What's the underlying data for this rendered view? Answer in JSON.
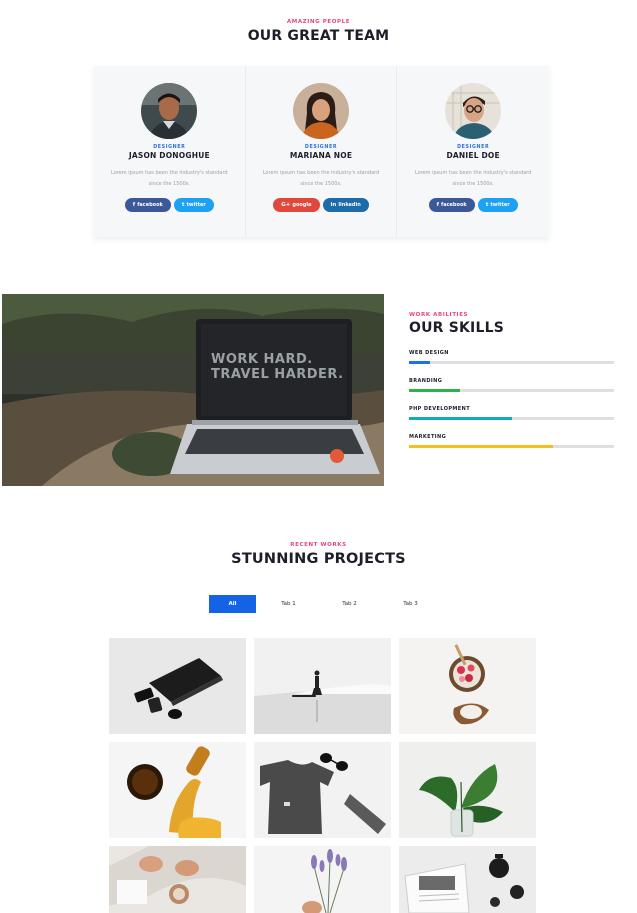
{
  "team": {
    "eyebrow": "AMAZING PEOPLE",
    "title": "OUR GREAT TEAM",
    "members": [
      {
        "role": "DESIGNER",
        "name": "JASON DONOGHUE",
        "bio": "Lorem ipsum has been the industry's standard since the 1500s.",
        "buttons": [
          {
            "icon": "f",
            "label": "facebook"
          },
          {
            "icon": "t",
            "label": "twitter"
          }
        ]
      },
      {
        "role": "DESIGNER",
        "name": "MARIANA NOE",
        "bio": "Lorem ipsum has been the industry's standard since the 1500s.",
        "buttons": [
          {
            "icon": "G+",
            "label": "google"
          },
          {
            "icon": "in",
            "label": "linkedin"
          }
        ]
      },
      {
        "role": "DESIGNER",
        "name": "DANIEL DOE",
        "bio": "Lorem ipsum has been the industry's standard since the 1500s.",
        "buttons": [
          {
            "icon": "f",
            "label": "facebook"
          },
          {
            "icon": "t",
            "label": "twitter"
          }
        ]
      }
    ]
  },
  "hero": {
    "screen_text_1": "WORK HARD.",
    "screen_text_2": "TRAVEL HARDER."
  },
  "skills": {
    "eyebrow": "WORK ABILITIES",
    "title": "OUR SKILLS",
    "items": [
      {
        "name": "WEB DESIGN",
        "percent": 10,
        "color": "#1a73e8"
      },
      {
        "name": "BRANDING",
        "percent": 25,
        "color": "#2bb24c"
      },
      {
        "name": "PHP DEVELOPMENT",
        "percent": 50,
        "color": "#14a9b8"
      },
      {
        "name": "MARKETING",
        "percent": 70,
        "color": "#f4c020"
      }
    ]
  },
  "projects": {
    "eyebrow": "RECENT WORKS",
    "title": "STUNNING PROJECTS",
    "tabs": [
      "All",
      "Tab 1",
      "Tab 2",
      "Tab 3"
    ],
    "active_tab": "All"
  },
  "colors": {
    "accent_pink": "#f0437a",
    "accent_blue": "#1463e6",
    "heading": "#1e1e2a"
  }
}
